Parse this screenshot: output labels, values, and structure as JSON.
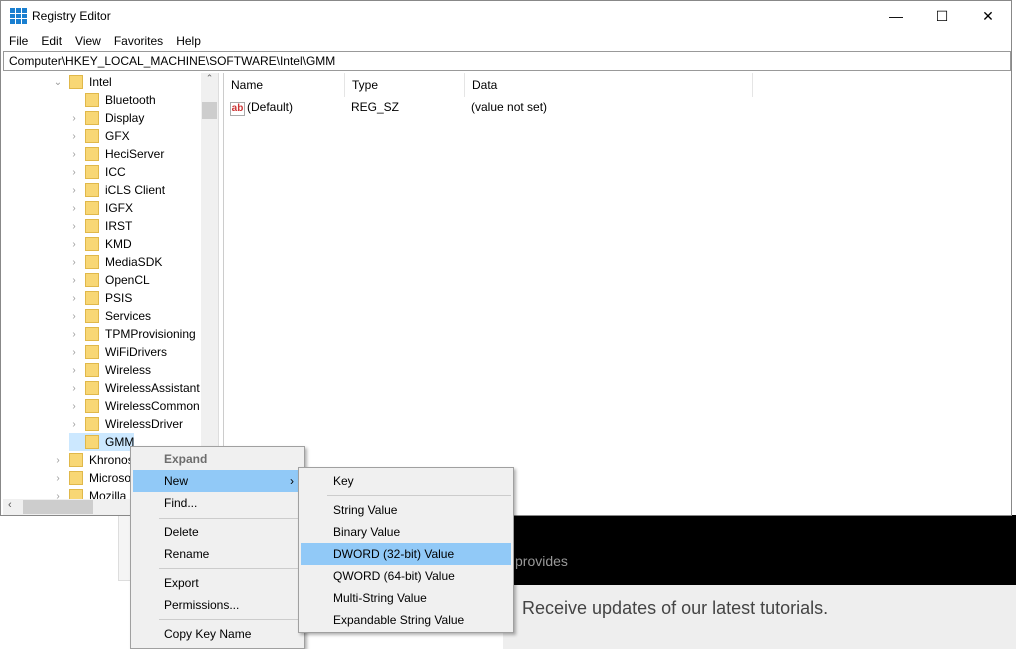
{
  "window": {
    "title": "Registry Editor",
    "minimize": "—",
    "maximize": "☐",
    "close": "✕"
  },
  "menubar": [
    "File",
    "Edit",
    "View",
    "Favorites",
    "Help"
  ],
  "address": "Computer\\HKEY_LOCAL_MACHINE\\SOFTWARE\\Intel\\GMM",
  "tree": {
    "parent": "Intel",
    "children": [
      "Bluetooth",
      "Display",
      "GFX",
      "HeciServer",
      "ICC",
      "iCLS Client",
      "IGFX",
      "IRST",
      "KMD",
      "MediaSDK",
      "OpenCL",
      "PSIS",
      "Services",
      "TPMProvisioning",
      "WiFiDrivers",
      "Wireless",
      "WirelessAssistant",
      "WirelessCommon",
      "WirelessDriver",
      "GMM"
    ],
    "siblings": [
      "Khronos",
      "Microsoft",
      "Mozilla"
    ]
  },
  "columns": [
    "Name",
    "Type",
    "Data"
  ],
  "values": [
    {
      "name": "(Default)",
      "type": "REG_SZ",
      "data": "(value not set)"
    }
  ],
  "context_menu": {
    "expand": "Expand",
    "new": "New",
    "find": "Find...",
    "delete": "Delete",
    "rename": "Rename",
    "export": "Export",
    "permissions": "Permissions...",
    "copy": "Copy Key Name"
  },
  "submenu": {
    "key": "Key",
    "string": "String Value",
    "binary": "Binary Value",
    "dword": "DWORD (32-bit) Value",
    "qword": "QWORD (64-bit) Value",
    "multi": "Multi-String Value",
    "expandable": "Expandable String Value"
  },
  "background": {
    "provides": "provides",
    "receive": "Receive updates of our latest tutorials."
  }
}
